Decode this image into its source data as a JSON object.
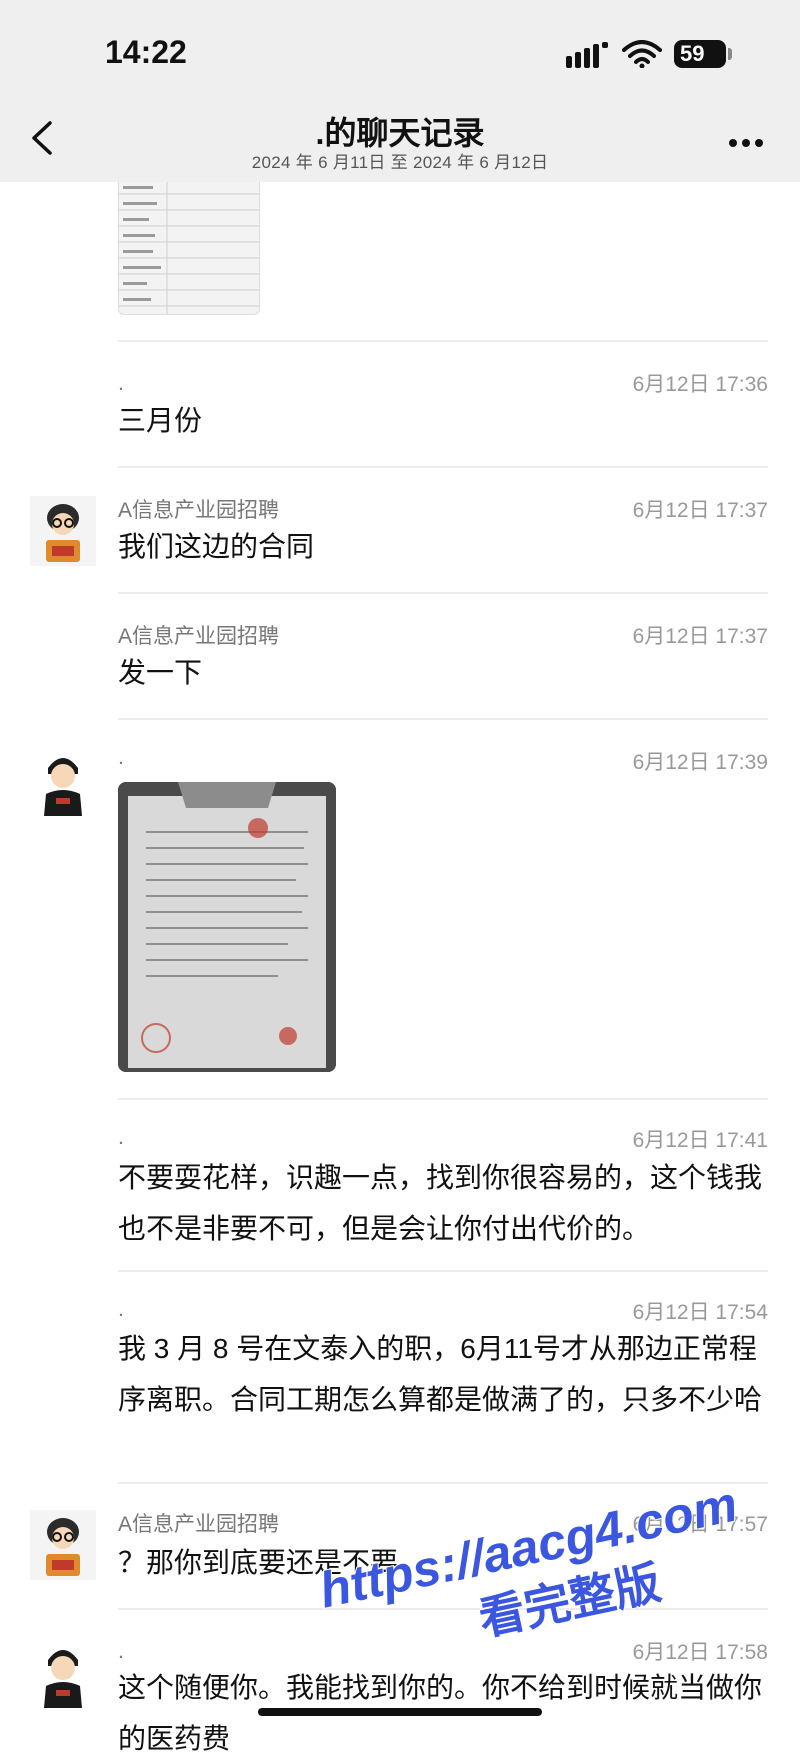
{
  "status_bar": {
    "time": "14:22",
    "battery": "59"
  },
  "header": {
    "title": ".的聊天记录",
    "subtitle": "2024 年 6 月11日 至 2024 年 6 月12日"
  },
  "messages": [
    {
      "sender": ".",
      "time": "6月12日 17:36",
      "text": "三月份"
    },
    {
      "sender": "A信息产业园招聘",
      "time": "6月12日 17:37",
      "text": "我们这边的合同"
    },
    {
      "sender": "A信息产业园招聘",
      "time": "6月12日 17:37",
      "text": "发一下"
    },
    {
      "sender": ".",
      "time": "6月12日 17:39",
      "text": ""
    },
    {
      "sender": ".",
      "time": "6月12日 17:41",
      "text": "不要耍花样，识趣一点，找到你很容易的，这个钱我也不是非要不可，但是会让你付出代价的。"
    },
    {
      "sender": ".",
      "time": "6月12日 17:54",
      "text": "我 3 月 8 号在文泰入的职，6月11号才从那边正常程序离职。合同工期怎么算都是做满了的，只多不少哈"
    },
    {
      "sender": "A信息产业园招聘",
      "time": "6月12日 17:57",
      "text": "？那你到底要还是不要"
    },
    {
      "sender": ".",
      "time": "6月12日 17:58",
      "text": "这个随便你。我能找到你的。你不给到时候就当做你的医药费"
    }
  ],
  "watermark": {
    "line1": "https://aacg4.com",
    "line2": "看完整版"
  },
  "colors": {
    "header_bg": "#efefef",
    "watermark": "#3b57e0",
    "avatar_red": "#c0392b"
  }
}
